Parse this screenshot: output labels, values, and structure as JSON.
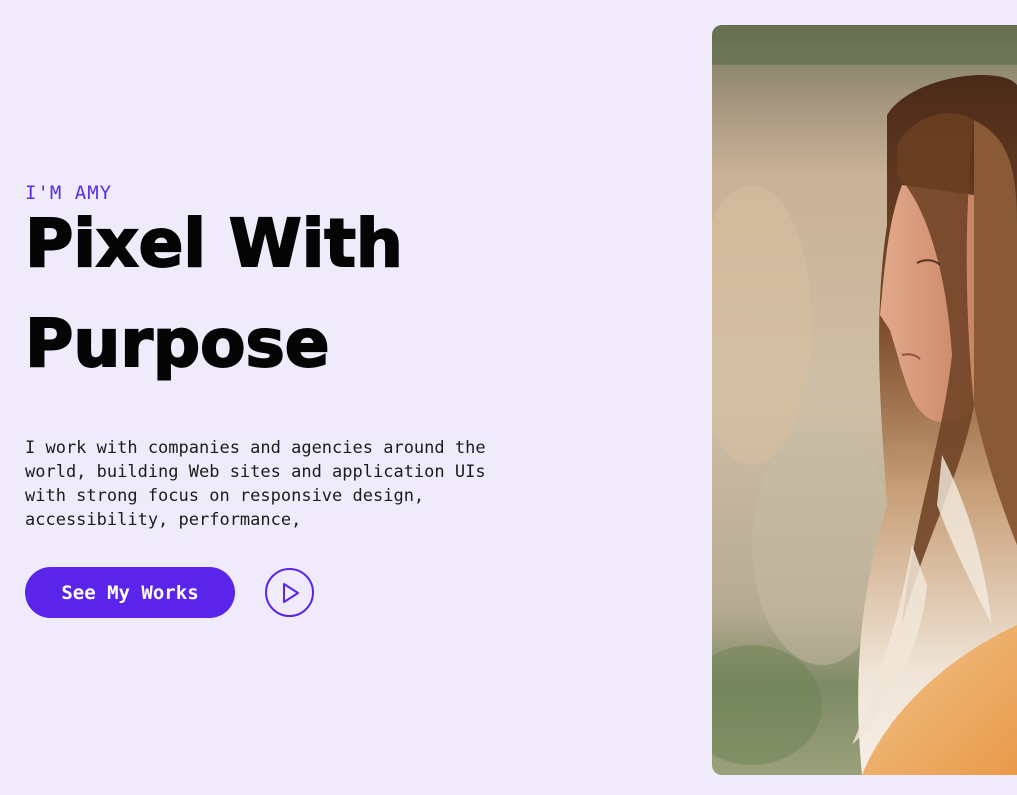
{
  "hero": {
    "eyebrow": "I'M AMY",
    "headline_line1": "Pixel With",
    "headline_line2": "Purpose",
    "description": "I work with companies and agencies around the world, building Web sites and application UIs with strong focus on responsive design, accessibility, performance,"
  },
  "actions": {
    "cta_label": "See My Works",
    "play_icon": "play-icon"
  },
  "colors": {
    "background": "#efebfa",
    "accent": "#5b24ea",
    "headline": "#050505"
  },
  "photo": {
    "subject": "portrait-photo"
  }
}
